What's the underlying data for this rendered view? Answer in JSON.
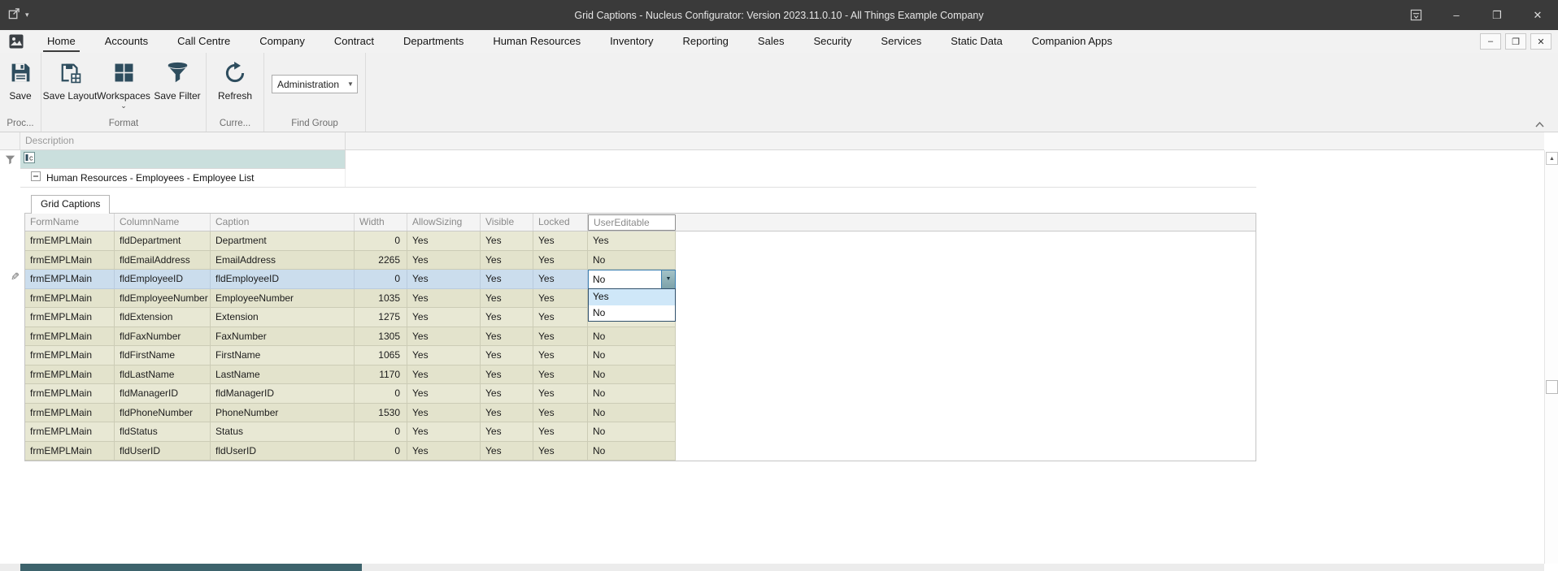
{
  "titlebar": {
    "title": "Grid Captions - Nucleus Configurator: Version 2023.11.0.10 - All Things Example Company"
  },
  "tabs": [
    {
      "label": "Home",
      "selected": true
    },
    {
      "label": "Accounts"
    },
    {
      "label": "Call Centre"
    },
    {
      "label": "Company"
    },
    {
      "label": "Contract"
    },
    {
      "label": "Departments"
    },
    {
      "label": "Human Resources"
    },
    {
      "label": "Inventory"
    },
    {
      "label": "Reporting"
    },
    {
      "label": "Sales"
    },
    {
      "label": "Security"
    },
    {
      "label": "Services"
    },
    {
      "label": "Static Data"
    },
    {
      "label": "Companion Apps"
    }
  ],
  "ribbon": {
    "buttons": {
      "save": "Save",
      "save_layout": "Save Layout",
      "workspaces": "Workspaces",
      "save_filter": "Save Filter",
      "refresh": "Refresh"
    },
    "find_group_value": "Administration",
    "group_labels": {
      "process": "Proc...",
      "format": "Format",
      "current": "Curre...",
      "find_group": "Find Group"
    }
  },
  "outer_grid": {
    "description_header": "Description",
    "group_row_label": "Human Resources - Employees - Employee List"
  },
  "detail": {
    "tab_label": "Grid Captions",
    "columns": [
      "FormName",
      "ColumnName",
      "Caption",
      "Width",
      "AllowSizing",
      "Visible",
      "Locked",
      "UserEditable"
    ],
    "selected_row_index": 2,
    "rows": [
      [
        "frmEMPLMain",
        "fldDepartment",
        "Department",
        "0",
        "Yes",
        "Yes",
        "Yes",
        "Yes"
      ],
      [
        "frmEMPLMain",
        "fldEmailAddress",
        "EmailAddress",
        "2265",
        "Yes",
        "Yes",
        "Yes",
        "No"
      ],
      [
        "frmEMPLMain",
        "fldEmployeeID",
        "fldEmployeeID",
        "0",
        "Yes",
        "Yes",
        "Yes",
        ""
      ],
      [
        "frmEMPLMain",
        "fldEmployeeNumber",
        "EmployeeNumber",
        "1035",
        "Yes",
        "Yes",
        "Yes",
        ""
      ],
      [
        "frmEMPLMain",
        "fldExtension",
        "Extension",
        "1275",
        "Yes",
        "Yes",
        "Yes",
        ""
      ],
      [
        "frmEMPLMain",
        "fldFaxNumber",
        "FaxNumber",
        "1305",
        "Yes",
        "Yes",
        "Yes",
        "No"
      ],
      [
        "frmEMPLMain",
        "fldFirstName",
        "FirstName",
        "1065",
        "Yes",
        "Yes",
        "Yes",
        "No"
      ],
      [
        "frmEMPLMain",
        "fldLastName",
        "LastName",
        "1170",
        "Yes",
        "Yes",
        "Yes",
        "No"
      ],
      [
        "frmEMPLMain",
        "fldManagerID",
        "fldManagerID",
        "0",
        "Yes",
        "Yes",
        "Yes",
        "No"
      ],
      [
        "frmEMPLMain",
        "fldPhoneNumber",
        "PhoneNumber",
        "1530",
        "Yes",
        "Yes",
        "Yes",
        "No"
      ],
      [
        "frmEMPLMain",
        "fldStatus",
        "Status",
        "0",
        "Yes",
        "Yes",
        "Yes",
        "No"
      ],
      [
        "frmEMPLMain",
        "fldUserID",
        "fldUserID",
        "0",
        "Yes",
        "Yes",
        "Yes",
        "No"
      ]
    ]
  },
  "editor": {
    "value": "No",
    "options": [
      "Yes",
      "No"
    ],
    "highlighted_option": "Yes"
  },
  "icons": {
    "titlebar": [
      "app-menu-icon",
      "quick-access-dropdown-icon",
      "ribbon-display-options-icon",
      "minimize-icon",
      "maximize-icon",
      "close-icon"
    ],
    "ribbon": [
      "save-icon",
      "save-layout-icon",
      "workspaces-icon",
      "save-filter-icon",
      "refresh-icon",
      "collapse-ribbon-icon"
    ],
    "grid": [
      "filter-funnel-icon",
      "auto-filter-edit-icon",
      "collapse-row-icon",
      "edit-pencil-icon",
      "dropdown-arrow-icon",
      "scroll-up-icon"
    ]
  },
  "colors": {
    "titlebar_bg": "#3a3a3a",
    "ribbon_bg": "#f1f1f1",
    "row_olive": "#e8e8d4",
    "row_olive_alt": "#e3e3cc",
    "row_selected": "#cbdded",
    "filter_row_teal": "#cadfdd",
    "editor_border_blue": "#3c7fb1",
    "icon_navy": "#2e4d5e",
    "hscroll_thumb": "#3d636c"
  }
}
